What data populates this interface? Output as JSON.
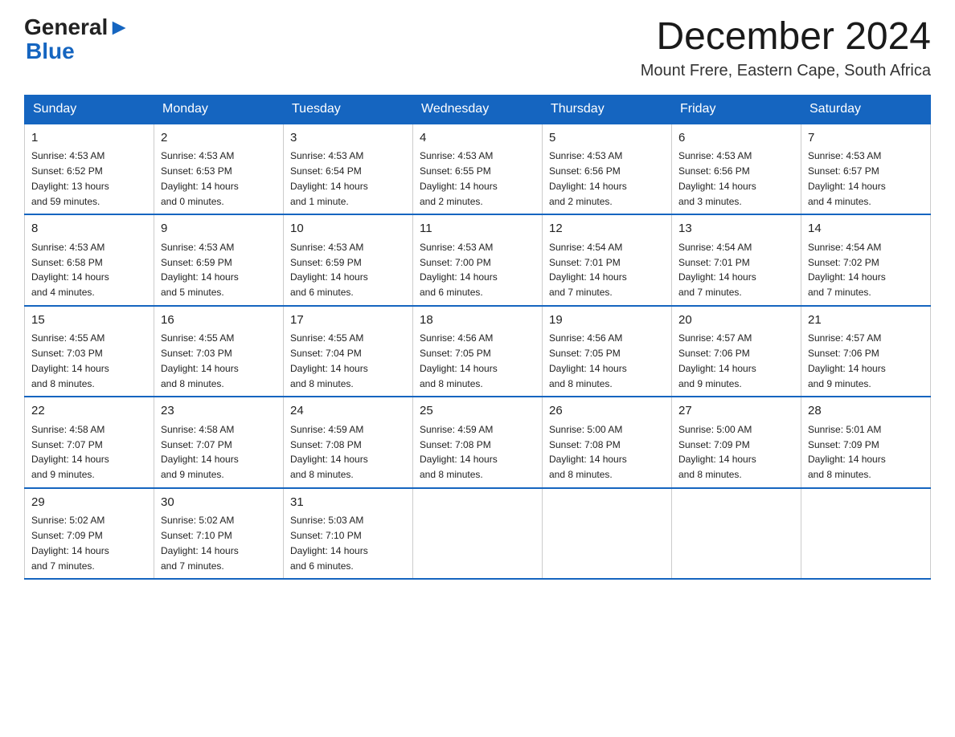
{
  "header": {
    "logo": {
      "general": "General",
      "blue": "Blue",
      "aria": "GeneralBlue logo"
    },
    "month": "December 2024",
    "location": "Mount Frere, Eastern Cape, South Africa"
  },
  "days_of_week": [
    "Sunday",
    "Monday",
    "Tuesday",
    "Wednesday",
    "Thursday",
    "Friday",
    "Saturday"
  ],
  "weeks": [
    [
      {
        "day": 1,
        "sunrise": "4:53 AM",
        "sunset": "6:52 PM",
        "daylight": "13 hours and 59 minutes."
      },
      {
        "day": 2,
        "sunrise": "4:53 AM",
        "sunset": "6:53 PM",
        "daylight": "14 hours and 0 minutes."
      },
      {
        "day": 3,
        "sunrise": "4:53 AM",
        "sunset": "6:54 PM",
        "daylight": "14 hours and 1 minute."
      },
      {
        "day": 4,
        "sunrise": "4:53 AM",
        "sunset": "6:55 PM",
        "daylight": "14 hours and 2 minutes."
      },
      {
        "day": 5,
        "sunrise": "4:53 AM",
        "sunset": "6:56 PM",
        "daylight": "14 hours and 2 minutes."
      },
      {
        "day": 6,
        "sunrise": "4:53 AM",
        "sunset": "6:56 PM",
        "daylight": "14 hours and 3 minutes."
      },
      {
        "day": 7,
        "sunrise": "4:53 AM",
        "sunset": "6:57 PM",
        "daylight": "14 hours and 4 minutes."
      }
    ],
    [
      {
        "day": 8,
        "sunrise": "4:53 AM",
        "sunset": "6:58 PM",
        "daylight": "14 hours and 4 minutes."
      },
      {
        "day": 9,
        "sunrise": "4:53 AM",
        "sunset": "6:59 PM",
        "daylight": "14 hours and 5 minutes."
      },
      {
        "day": 10,
        "sunrise": "4:53 AM",
        "sunset": "6:59 PM",
        "daylight": "14 hours and 6 minutes."
      },
      {
        "day": 11,
        "sunrise": "4:53 AM",
        "sunset": "7:00 PM",
        "daylight": "14 hours and 6 minutes."
      },
      {
        "day": 12,
        "sunrise": "4:54 AM",
        "sunset": "7:01 PM",
        "daylight": "14 hours and 7 minutes."
      },
      {
        "day": 13,
        "sunrise": "4:54 AM",
        "sunset": "7:01 PM",
        "daylight": "14 hours and 7 minutes."
      },
      {
        "day": 14,
        "sunrise": "4:54 AM",
        "sunset": "7:02 PM",
        "daylight": "14 hours and 7 minutes."
      }
    ],
    [
      {
        "day": 15,
        "sunrise": "4:55 AM",
        "sunset": "7:03 PM",
        "daylight": "14 hours and 8 minutes."
      },
      {
        "day": 16,
        "sunrise": "4:55 AM",
        "sunset": "7:03 PM",
        "daylight": "14 hours and 8 minutes."
      },
      {
        "day": 17,
        "sunrise": "4:55 AM",
        "sunset": "7:04 PM",
        "daylight": "14 hours and 8 minutes."
      },
      {
        "day": 18,
        "sunrise": "4:56 AM",
        "sunset": "7:05 PM",
        "daylight": "14 hours and 8 minutes."
      },
      {
        "day": 19,
        "sunrise": "4:56 AM",
        "sunset": "7:05 PM",
        "daylight": "14 hours and 8 minutes."
      },
      {
        "day": 20,
        "sunrise": "4:57 AM",
        "sunset": "7:06 PM",
        "daylight": "14 hours and 9 minutes."
      },
      {
        "day": 21,
        "sunrise": "4:57 AM",
        "sunset": "7:06 PM",
        "daylight": "14 hours and 9 minutes."
      }
    ],
    [
      {
        "day": 22,
        "sunrise": "4:58 AM",
        "sunset": "7:07 PM",
        "daylight": "14 hours and 9 minutes."
      },
      {
        "day": 23,
        "sunrise": "4:58 AM",
        "sunset": "7:07 PM",
        "daylight": "14 hours and 9 minutes."
      },
      {
        "day": 24,
        "sunrise": "4:59 AM",
        "sunset": "7:08 PM",
        "daylight": "14 hours and 8 minutes."
      },
      {
        "day": 25,
        "sunrise": "4:59 AM",
        "sunset": "7:08 PM",
        "daylight": "14 hours and 8 minutes."
      },
      {
        "day": 26,
        "sunrise": "5:00 AM",
        "sunset": "7:08 PM",
        "daylight": "14 hours and 8 minutes."
      },
      {
        "day": 27,
        "sunrise": "5:00 AM",
        "sunset": "7:09 PM",
        "daylight": "14 hours and 8 minutes."
      },
      {
        "day": 28,
        "sunrise": "5:01 AM",
        "sunset": "7:09 PM",
        "daylight": "14 hours and 8 minutes."
      }
    ],
    [
      {
        "day": 29,
        "sunrise": "5:02 AM",
        "sunset": "7:09 PM",
        "daylight": "14 hours and 7 minutes."
      },
      {
        "day": 30,
        "sunrise": "5:02 AM",
        "sunset": "7:10 PM",
        "daylight": "14 hours and 7 minutes."
      },
      {
        "day": 31,
        "sunrise": "5:03 AM",
        "sunset": "7:10 PM",
        "daylight": "14 hours and 6 minutes."
      },
      null,
      null,
      null,
      null
    ]
  ],
  "labels": {
    "sunrise": "Sunrise:",
    "sunset": "Sunset:",
    "daylight": "Daylight:"
  }
}
